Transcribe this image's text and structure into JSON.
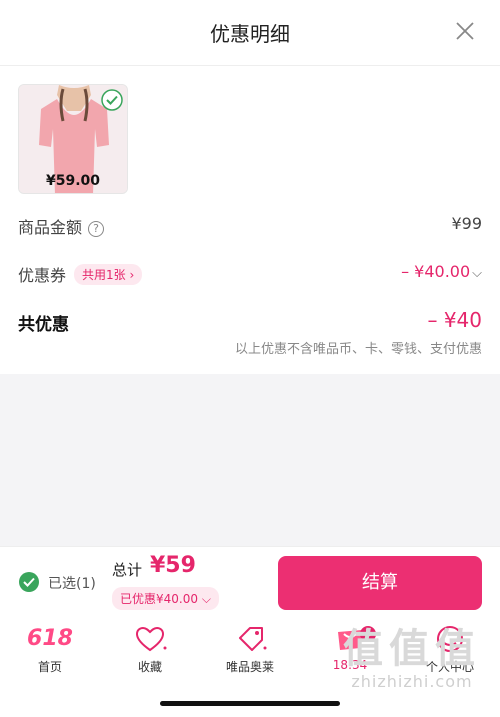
{
  "header": {
    "title": "优惠明细"
  },
  "product": {
    "price": "¥59.00"
  },
  "rows": {
    "goods_amount": {
      "label": "商品金额",
      "value": "¥99"
    },
    "coupon": {
      "label": "优惠券",
      "badge": "共用1张",
      "value": "– ¥40.00"
    },
    "total_discount": {
      "label": "共优惠",
      "value": "– ¥40",
      "note": "以上优惠不含唯品币、卡、零钱、支付优惠"
    }
  },
  "bottom": {
    "selected": "已选(1)",
    "total_label": "总计",
    "total_value": "¥59",
    "discount_pill": "已优惠¥40.00",
    "checkout": "结算"
  },
  "tabs": [
    {
      "label": "首页",
      "icon": "618-logo",
      "logo_text": "618"
    },
    {
      "label": "收藏",
      "icon": "heart-icon"
    },
    {
      "label": "唯品奥莱",
      "icon": "tag-icon"
    },
    {
      "label": "18:34",
      "icon": "cart-icon",
      "badge": "1"
    },
    {
      "label": "个人中心",
      "icon": "person-icon"
    }
  ],
  "watermark": {
    "big": "值值值",
    "url": "zhizhizhi.com"
  },
  "colors": {
    "accent": "#e5266b",
    "button": "#ec2f72",
    "check": "#3aa55c"
  }
}
